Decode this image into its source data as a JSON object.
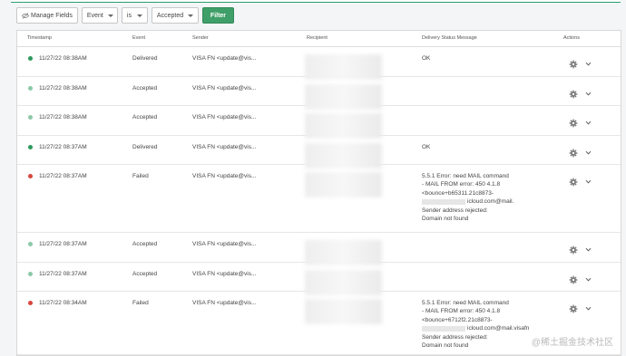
{
  "toolbar": {
    "manage_fields": "Manage Fields",
    "event_select": "Event",
    "operator_select": "is",
    "value_select": "Accepted",
    "filter": "Filter"
  },
  "table": {
    "headers": {
      "timestamp": "Timestamp",
      "event": "Event",
      "sender": "Sender",
      "recipient": "Recipient",
      "delivery": "Delivery Status Message",
      "actions": "Actions"
    },
    "rows": [
      {
        "status_color": "#2e9a5e",
        "timestamp": "11/27/22 08:38AM",
        "event": "Delivered",
        "sender": "VISA FN <update@vis...",
        "message": [
          "OK"
        ]
      },
      {
        "status_color": "#8cc9a8",
        "timestamp": "11/27/22 08:38AM",
        "event": "Accepted",
        "sender": "VISA FN <update@vis...",
        "message": []
      },
      {
        "status_color": "#8cc9a8",
        "timestamp": "11/27/22 08:38AM",
        "event": "Accepted",
        "sender": "VISA FN <update@vis...",
        "message": []
      },
      {
        "status_color": "#2e9a5e",
        "timestamp": "11/27/22 08:37AM",
        "event": "Delivered",
        "sender": "VISA FN <update@vis...",
        "message": [
          "OK"
        ]
      },
      {
        "status_color": "#d9453f",
        "timestamp": "11/27/22 08:37AM",
        "event": "Failed",
        "sender": "VISA FN <update@vis...",
        "message": [
          "5.5.1 Error: need MAIL command",
          "- MAIL FROM error: 450 4.1.8",
          "<bounce+b65311.21c8873-",
          "icloud.com@mail.",
          "Sender address rejected:",
          "Domain not found"
        ]
      },
      {
        "status_color": "#8cc9a8",
        "timestamp": "11/27/22 08:37AM",
        "event": "Accepted",
        "sender": "VISA FN <update@vis...",
        "message": []
      },
      {
        "status_color": "#8cc9a8",
        "timestamp": "11/27/22 08:37AM",
        "event": "Accepted",
        "sender": "VISA FN <update@vis...",
        "message": []
      },
      {
        "status_color": "#d9453f",
        "timestamp": "11/27/22 08:34AM",
        "event": "Failed",
        "sender": "VISA FN <update@vis...",
        "message": [
          "5.5.1 Error: need MAIL command",
          "- MAIL FROM error: 450 4.1.8",
          "<bounce+6712f2.21c8873-",
          "icloud.com@mail.visafn",
          "Sender address rejected:",
          "Domain not found"
        ]
      }
    ]
  },
  "watermark": "@稀土掘金技术社区"
}
